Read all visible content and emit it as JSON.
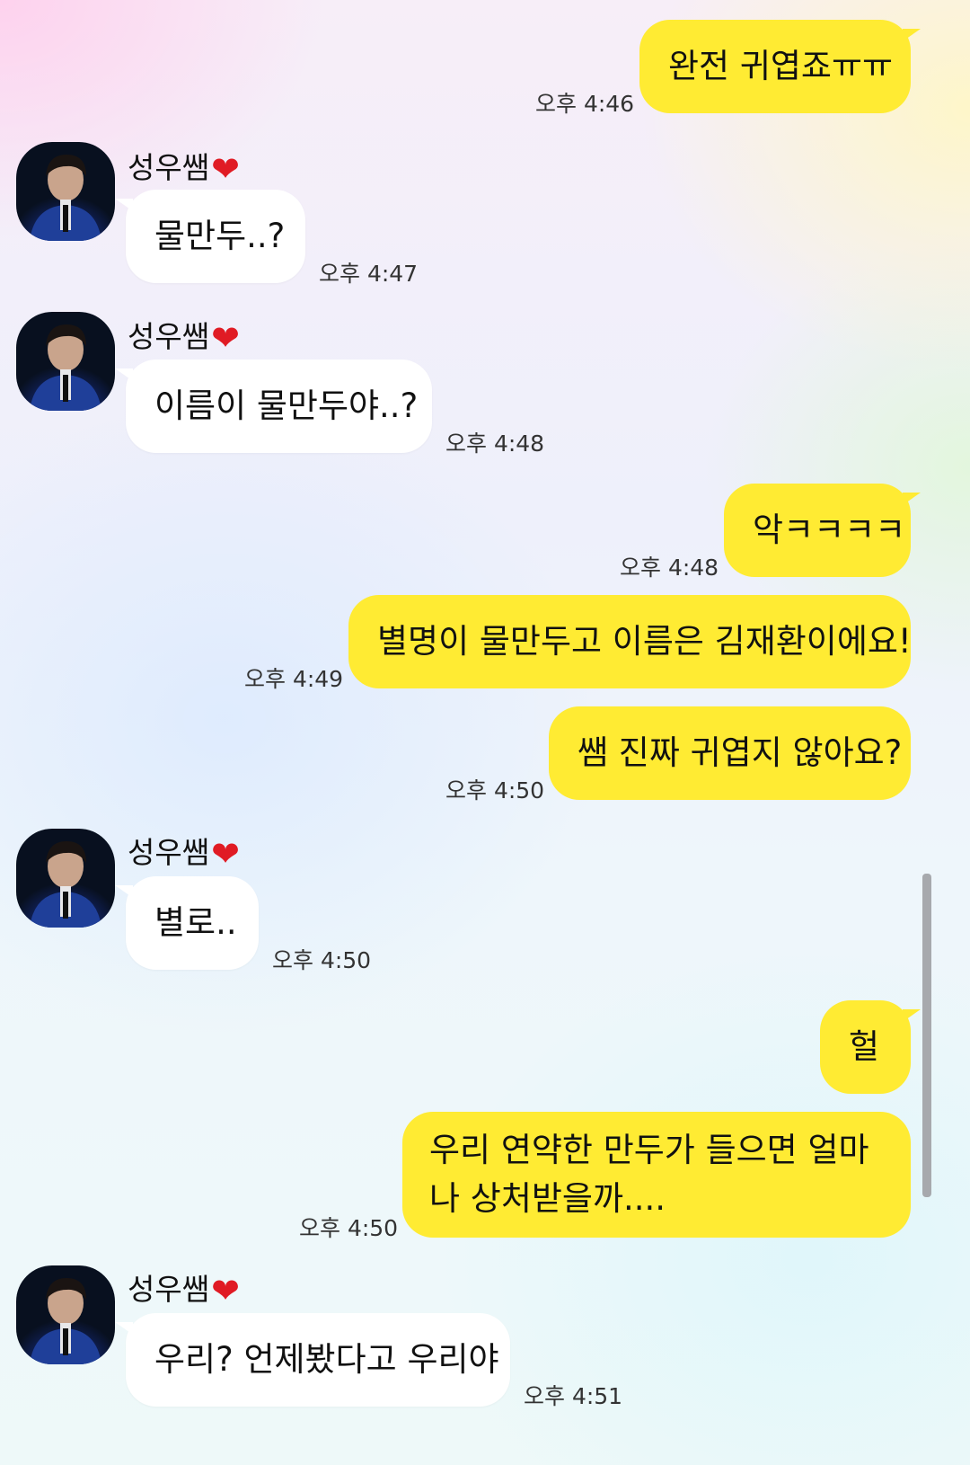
{
  "sender_name": "성우쌤",
  "sender_heart": "❤",
  "messages": [
    {
      "from": "me",
      "text": "완전 귀엽죠ㅠㅠ",
      "time": "오후 4:46"
    },
    {
      "from": "them",
      "text": "물만두..?",
      "time": "오후 4:47"
    },
    {
      "from": "them",
      "text": "이름이 물만두야..?",
      "time": "오후 4:48"
    },
    {
      "from": "me",
      "text": "악ㅋㅋㅋㅋ",
      "time": "오후 4:48"
    },
    {
      "from": "me",
      "text": "별명이 물만두고 이름은 김재환이에요!",
      "time": "오후 4:49"
    },
    {
      "from": "me",
      "text": "쌤 진짜 귀엽지 않아요?",
      "time": "오후 4:50"
    },
    {
      "from": "them",
      "text": "별로..",
      "time": "오후 4:50"
    },
    {
      "from": "me",
      "text": "헐",
      "time": ""
    },
    {
      "from": "me",
      "text": "우리 연약한 만두가 들으면 얼마나 상처받을까....",
      "time": "오후 4:50"
    },
    {
      "from": "them",
      "text": "우리? 언제봤다고 우리야",
      "time": "오후 4:51"
    }
  ],
  "colors": {
    "my_bubble": "#ffeb33",
    "their_bubble": "#ffffff",
    "heart": "#e01b24"
  }
}
